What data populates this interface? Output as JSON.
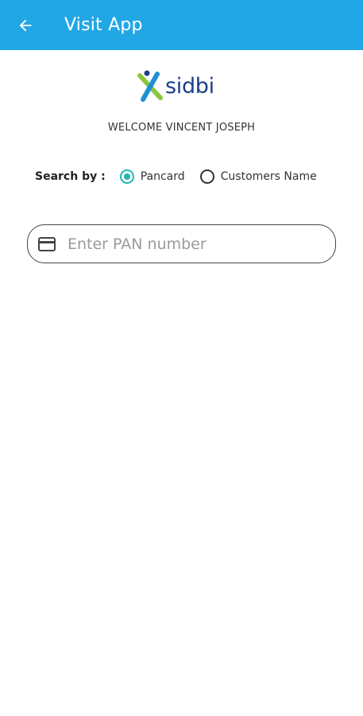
{
  "appbar": {
    "title": "Visit App",
    "back_icon": "arrow-left-icon",
    "background": "#22a7e6"
  },
  "logo": {
    "text": "sidbi"
  },
  "welcome": {
    "text": "WELCOME VINCENT JOSEPH"
  },
  "search": {
    "label": "Search by :",
    "options": [
      {
        "label": "Pancard",
        "selected": true
      },
      {
        "label": "Customers Name",
        "selected": false
      }
    ],
    "accent": "#1fb9b0"
  },
  "pan_field": {
    "placeholder": "Enter PAN number",
    "value": "",
    "icon": "credit-card-icon"
  }
}
